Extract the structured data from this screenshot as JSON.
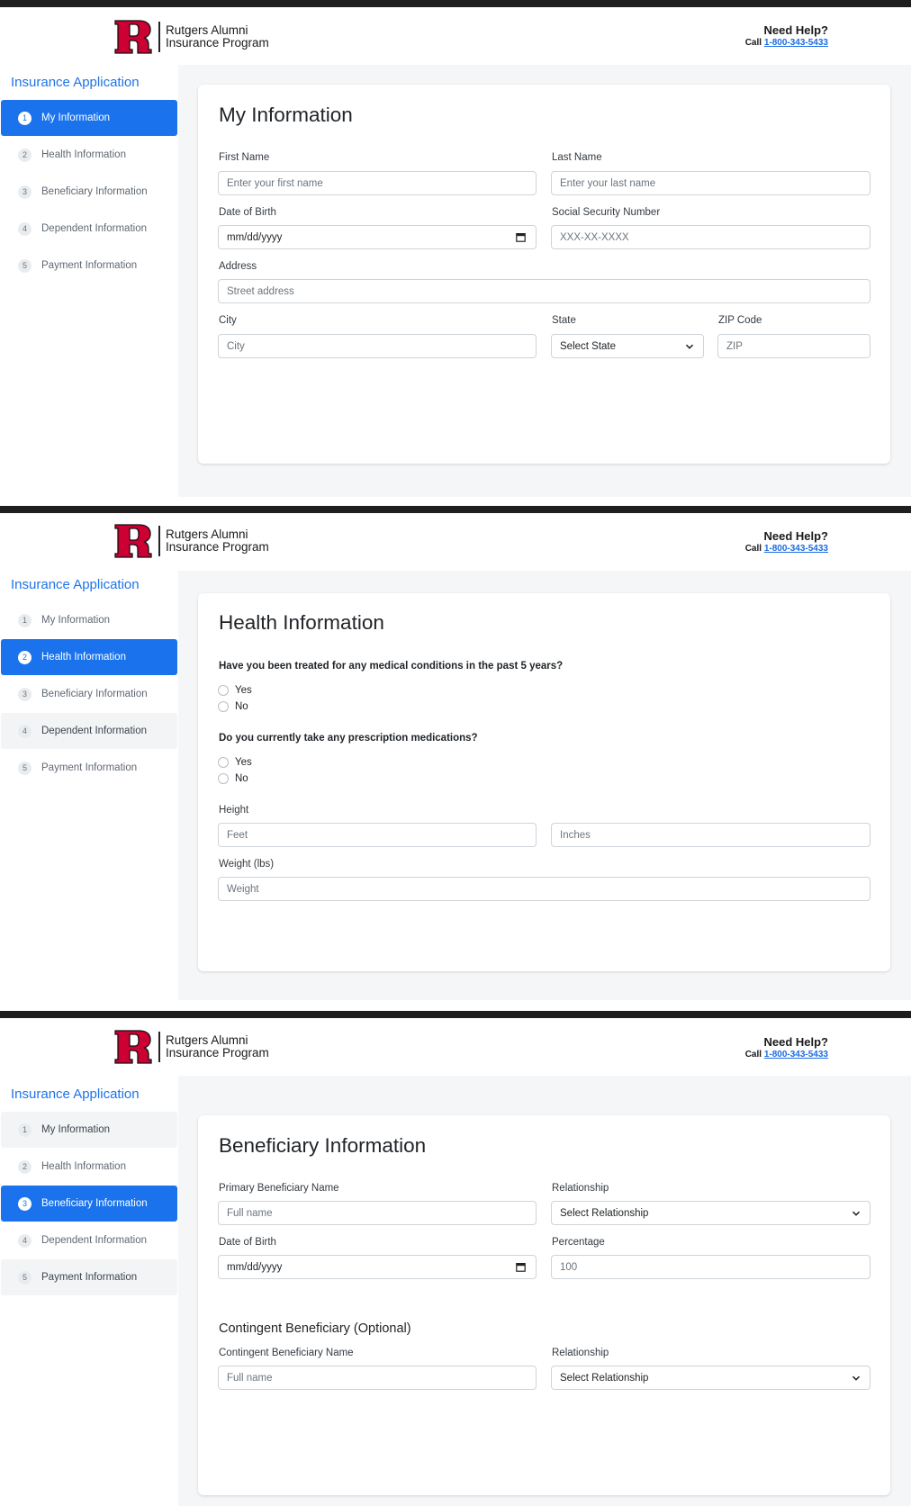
{
  "brand": {
    "logo_line1": "Rutgers Alumni",
    "logo_line2": "Insurance Program",
    "logo_color": "#cc0033"
  },
  "help": {
    "title": "Need Help?",
    "call_label": "Call",
    "phone": "1-800-343-5433"
  },
  "sidebar": {
    "title": "Insurance Application",
    "items": [
      {
        "num": "1",
        "label": "My Information"
      },
      {
        "num": "2",
        "label": "Health Information"
      },
      {
        "num": "3",
        "label": "Beneficiary Information"
      },
      {
        "num": "4",
        "label": "Dependent Information"
      },
      {
        "num": "5",
        "label": "Payment Information"
      }
    ]
  },
  "colors": {
    "accent": "#1a73ec",
    "topbar": "#1f1f1f",
    "content_bg": "#f5f6f8"
  },
  "my_info": {
    "title": "My Information",
    "first_name": {
      "label": "First Name",
      "placeholder": "Enter your first name"
    },
    "last_name": {
      "label": "Last Name",
      "placeholder": "Enter your last name"
    },
    "dob": {
      "label": "Date of Birth",
      "value": "mm/dd/yyyy"
    },
    "ssn": {
      "label": "Social Security Number",
      "placeholder": "XXX-XX-XXXX"
    },
    "address": {
      "label": "Address",
      "placeholder": "Street address"
    },
    "city": {
      "label": "City",
      "placeholder": "City"
    },
    "state": {
      "label": "State",
      "value": "Select State"
    },
    "zip": {
      "label": "ZIP Code",
      "placeholder": "ZIP"
    }
  },
  "health_info": {
    "title": "Health Information",
    "q1": "Have you been treated for any medical conditions in the past 5 years?",
    "q2": "Do you currently take any prescription medications?",
    "yes": "Yes",
    "no": "No",
    "height": {
      "label": "Height",
      "feet_placeholder": "Feet",
      "inches_placeholder": "Inches"
    },
    "weight": {
      "label": "Weight (lbs)",
      "placeholder": "Weight"
    }
  },
  "beneficiary_info": {
    "title": "Beneficiary Information",
    "primary_name": {
      "label": "Primary Beneficiary Name",
      "placeholder": "Full name"
    },
    "relationship": {
      "label": "Relationship",
      "value": "Select Relationship"
    },
    "dob": {
      "label": "Date of Birth",
      "value": "mm/dd/yyyy"
    },
    "percentage": {
      "label": "Percentage",
      "placeholder": "100"
    },
    "contingent_heading": "Contingent Beneficiary (Optional)",
    "contingent_name": {
      "label": "Contingent Beneficiary Name",
      "placeholder": "Full name"
    },
    "contingent_relationship": {
      "label": "Relationship",
      "value": "Select Relationship"
    }
  }
}
